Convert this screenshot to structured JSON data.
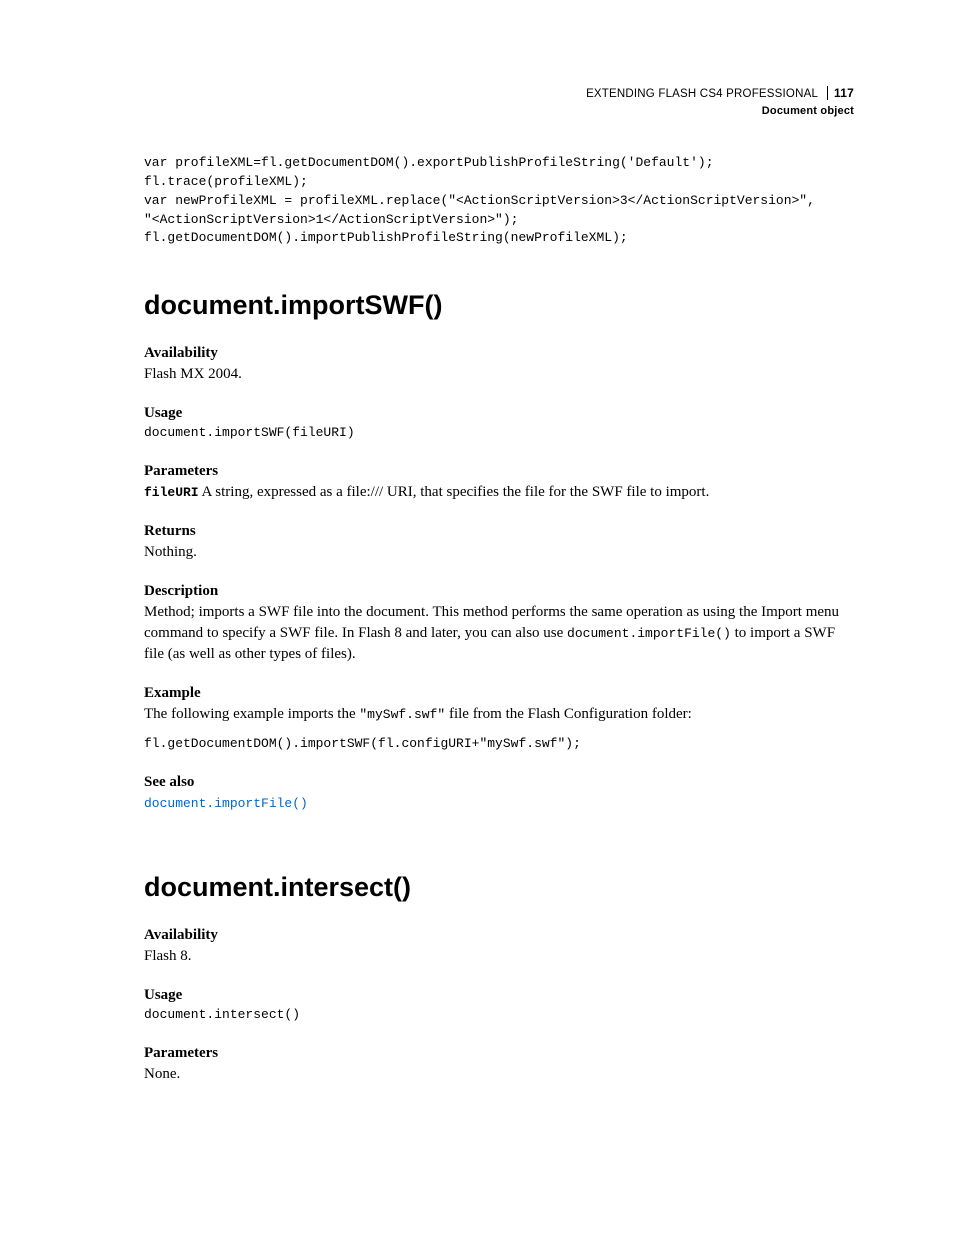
{
  "header": {
    "book_title": "EXTENDING FLASH CS4 PROFESSIONAL",
    "page_number": "117",
    "section": "Document object"
  },
  "top_code": "var profileXML=fl.getDocumentDOM().exportPublishProfileString('Default'); \nfl.trace(profileXML); \nvar newProfileXML = profileXML.replace(\"<ActionScriptVersion>3</ActionScriptVersion>\", \n\"<ActionScriptVersion>1</ActionScriptVersion>\"); \nfl.getDocumentDOM().importPublishProfileString(newProfileXML);",
  "method1": {
    "title": "document.importSWF()",
    "availability_h": "Availability",
    "availability_t": "Flash MX 2004.",
    "usage_h": "Usage",
    "usage_code": "document.importSWF(fileURI)",
    "parameters_h": "Parameters",
    "param_name": "fileURI",
    "param_desc": "  A string, expressed as a file:/// URI, that specifies the file for the SWF file to import.",
    "returns_h": "Returns",
    "returns_t": "Nothing.",
    "description_h": "Description",
    "description_t1": "Method; imports a SWF file into the document. This method performs the same operation as using the Import menu command to specify a SWF file. In Flash 8 and later, you can also use ",
    "description_code": "document.importFile()",
    "description_t2": " to import a SWF file (as well as other types of files).",
    "example_h": "Example",
    "example_t1": "The following example imports the ",
    "example_code_inline": "\"mySwf.swf\"",
    "example_t2": " file from the Flash Configuration folder:",
    "example_code": "fl.getDocumentDOM().importSWF(fl.configURI+\"mySwf.swf\");",
    "seealso_h": "See also",
    "seealso_link": "document.importFile()"
  },
  "method2": {
    "title": "document.intersect()",
    "availability_h": "Availability",
    "availability_t": "Flash 8.",
    "usage_h": "Usage",
    "usage_code": "document.intersect()",
    "parameters_h": "Parameters",
    "parameters_t": "None."
  }
}
